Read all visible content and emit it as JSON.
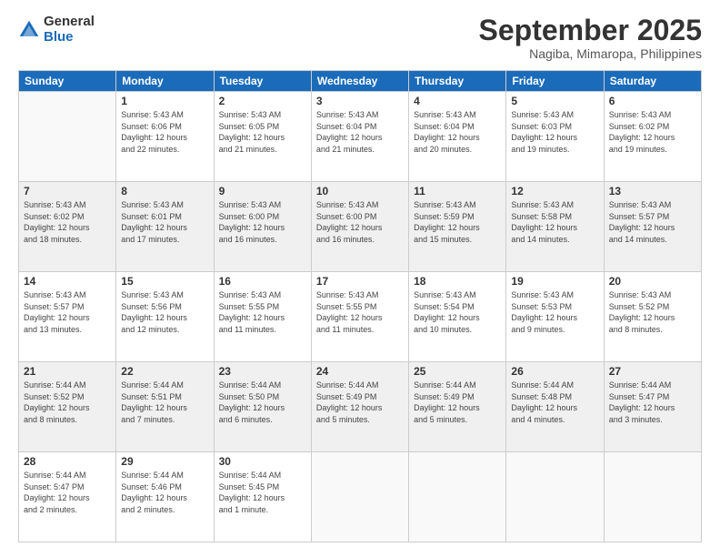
{
  "logo": {
    "general": "General",
    "blue": "Blue"
  },
  "title": "September 2025",
  "subtitle": "Nagiba, Mimaropa, Philippines",
  "days_of_week": [
    "Sunday",
    "Monday",
    "Tuesday",
    "Wednesday",
    "Thursday",
    "Friday",
    "Saturday"
  ],
  "weeks": [
    [
      {
        "day": "",
        "info": ""
      },
      {
        "day": "1",
        "info": "Sunrise: 5:43 AM\nSunset: 6:06 PM\nDaylight: 12 hours\nand 22 minutes."
      },
      {
        "day": "2",
        "info": "Sunrise: 5:43 AM\nSunset: 6:05 PM\nDaylight: 12 hours\nand 21 minutes."
      },
      {
        "day": "3",
        "info": "Sunrise: 5:43 AM\nSunset: 6:04 PM\nDaylight: 12 hours\nand 21 minutes."
      },
      {
        "day": "4",
        "info": "Sunrise: 5:43 AM\nSunset: 6:04 PM\nDaylight: 12 hours\nand 20 minutes."
      },
      {
        "day": "5",
        "info": "Sunrise: 5:43 AM\nSunset: 6:03 PM\nDaylight: 12 hours\nand 19 minutes."
      },
      {
        "day": "6",
        "info": "Sunrise: 5:43 AM\nSunset: 6:02 PM\nDaylight: 12 hours\nand 19 minutes."
      }
    ],
    [
      {
        "day": "7",
        "info": "Sunrise: 5:43 AM\nSunset: 6:02 PM\nDaylight: 12 hours\nand 18 minutes."
      },
      {
        "day": "8",
        "info": "Sunrise: 5:43 AM\nSunset: 6:01 PM\nDaylight: 12 hours\nand 17 minutes."
      },
      {
        "day": "9",
        "info": "Sunrise: 5:43 AM\nSunset: 6:00 PM\nDaylight: 12 hours\nand 16 minutes."
      },
      {
        "day": "10",
        "info": "Sunrise: 5:43 AM\nSunset: 6:00 PM\nDaylight: 12 hours\nand 16 minutes."
      },
      {
        "day": "11",
        "info": "Sunrise: 5:43 AM\nSunset: 5:59 PM\nDaylight: 12 hours\nand 15 minutes."
      },
      {
        "day": "12",
        "info": "Sunrise: 5:43 AM\nSunset: 5:58 PM\nDaylight: 12 hours\nand 14 minutes."
      },
      {
        "day": "13",
        "info": "Sunrise: 5:43 AM\nSunset: 5:57 PM\nDaylight: 12 hours\nand 14 minutes."
      }
    ],
    [
      {
        "day": "14",
        "info": "Sunrise: 5:43 AM\nSunset: 5:57 PM\nDaylight: 12 hours\nand 13 minutes."
      },
      {
        "day": "15",
        "info": "Sunrise: 5:43 AM\nSunset: 5:56 PM\nDaylight: 12 hours\nand 12 minutes."
      },
      {
        "day": "16",
        "info": "Sunrise: 5:43 AM\nSunset: 5:55 PM\nDaylight: 12 hours\nand 11 minutes."
      },
      {
        "day": "17",
        "info": "Sunrise: 5:43 AM\nSunset: 5:55 PM\nDaylight: 12 hours\nand 11 minutes."
      },
      {
        "day": "18",
        "info": "Sunrise: 5:43 AM\nSunset: 5:54 PM\nDaylight: 12 hours\nand 10 minutes."
      },
      {
        "day": "19",
        "info": "Sunrise: 5:43 AM\nSunset: 5:53 PM\nDaylight: 12 hours\nand 9 minutes."
      },
      {
        "day": "20",
        "info": "Sunrise: 5:43 AM\nSunset: 5:52 PM\nDaylight: 12 hours\nand 8 minutes."
      }
    ],
    [
      {
        "day": "21",
        "info": "Sunrise: 5:44 AM\nSunset: 5:52 PM\nDaylight: 12 hours\nand 8 minutes."
      },
      {
        "day": "22",
        "info": "Sunrise: 5:44 AM\nSunset: 5:51 PM\nDaylight: 12 hours\nand 7 minutes."
      },
      {
        "day": "23",
        "info": "Sunrise: 5:44 AM\nSunset: 5:50 PM\nDaylight: 12 hours\nand 6 minutes."
      },
      {
        "day": "24",
        "info": "Sunrise: 5:44 AM\nSunset: 5:49 PM\nDaylight: 12 hours\nand 5 minutes."
      },
      {
        "day": "25",
        "info": "Sunrise: 5:44 AM\nSunset: 5:49 PM\nDaylight: 12 hours\nand 5 minutes."
      },
      {
        "day": "26",
        "info": "Sunrise: 5:44 AM\nSunset: 5:48 PM\nDaylight: 12 hours\nand 4 minutes."
      },
      {
        "day": "27",
        "info": "Sunrise: 5:44 AM\nSunset: 5:47 PM\nDaylight: 12 hours\nand 3 minutes."
      }
    ],
    [
      {
        "day": "28",
        "info": "Sunrise: 5:44 AM\nSunset: 5:47 PM\nDaylight: 12 hours\nand 2 minutes."
      },
      {
        "day": "29",
        "info": "Sunrise: 5:44 AM\nSunset: 5:46 PM\nDaylight: 12 hours\nand 2 minutes."
      },
      {
        "day": "30",
        "info": "Sunrise: 5:44 AM\nSunset: 5:45 PM\nDaylight: 12 hours\nand 1 minute."
      },
      {
        "day": "",
        "info": ""
      },
      {
        "day": "",
        "info": ""
      },
      {
        "day": "",
        "info": ""
      },
      {
        "day": "",
        "info": ""
      }
    ]
  ]
}
